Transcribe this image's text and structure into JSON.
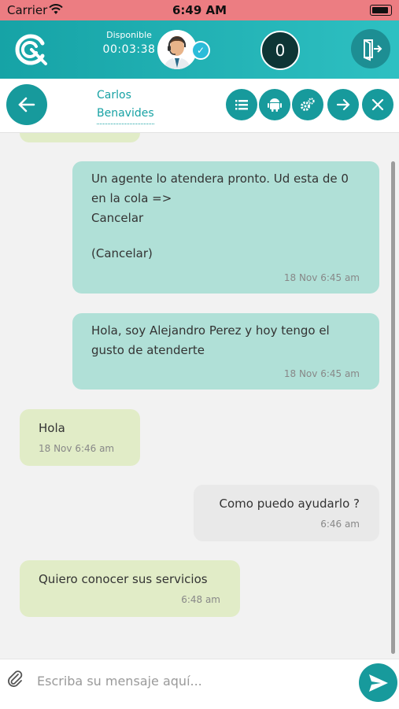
{
  "status_bar": {
    "carrier": "Carrier",
    "time": "6:49 AM"
  },
  "header": {
    "presence_label": "Disponible",
    "timer": "00:03:38",
    "queue_count": "0"
  },
  "contact": {
    "first_name": "Carlos",
    "last_name": "Benavides"
  },
  "messages": [
    {
      "lines": [
        "Un agente lo atendera pronto. Ud esta de 0",
        "en la cola =>",
        "Cancelar",
        "",
        "(Cancelar)"
      ],
      "time": "18 Nov 6:45 am"
    },
    {
      "lines": [
        "Hola, soy Alejandro Perez y hoy tengo el",
        "gusto de atenderte"
      ],
      "time": "18 Nov 6:45 am"
    },
    {
      "lines": [
        "Hola"
      ],
      "time": "18 Nov 6:46 am"
    },
    {
      "lines": [
        "Como puedo ayudarlo ?"
      ],
      "time": "6:46 am"
    },
    {
      "lines": [
        "Quiero conocer sus servicios"
      ],
      "time": "6:48 am"
    }
  ],
  "composer": {
    "placeholder": "Escriba su mensaje aquí..."
  },
  "colors": {
    "primary": "#179a9c",
    "header_gradient_start": "#16a3a6",
    "outgoing_bubble": "#b0e0d7",
    "incoming_bubble": "#e1ecc7",
    "agent_bubble": "#e9e9e9",
    "status_bar": "#ec7d82"
  },
  "icons": [
    "wifi-icon",
    "battery-icon",
    "logo-icon",
    "verified-icon",
    "exit-icon",
    "back-arrow-icon",
    "list-icon",
    "android-icon",
    "settings-icon",
    "forward-arrow-icon",
    "close-icon",
    "attachment-icon",
    "send-icon"
  ]
}
